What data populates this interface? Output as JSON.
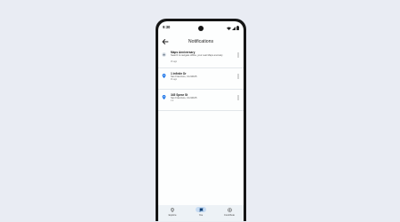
{
  "status_bar": {
    "time": "9:30"
  },
  "header": {
    "title": "Notifications"
  },
  "notifications": [
    {
      "title": "Maps Anniversary",
      "body": "Search & navigate offline, your Last Maps anomaly",
      "time": "2h ago",
      "icon": "star-icon",
      "icon_color": "#6c7a89"
    },
    {
      "title": "1 Infinite Dr",
      "body": "San Francisco, CA 94105",
      "time": "4h ago",
      "icon": "pin-icon",
      "icon_color": "#1a73e8"
    },
    {
      "title": "345 Spear St",
      "body": "San Francisco, CA 94105",
      "time": "1 d",
      "icon": "pin-icon",
      "icon_color": "#1a73e8"
    }
  ],
  "nav": {
    "items": [
      {
        "label": "Explore",
        "icon": "pin-icon",
        "active": false
      },
      {
        "label": "You",
        "icon": "flag-icon",
        "active": true
      },
      {
        "label": "Contribute",
        "icon": "add-circle-icon",
        "active": false
      }
    ]
  },
  "colors": {
    "accent": "#1a73e8",
    "nav_active_pill": "#c7dcf3",
    "background": "#e9ecf3"
  }
}
